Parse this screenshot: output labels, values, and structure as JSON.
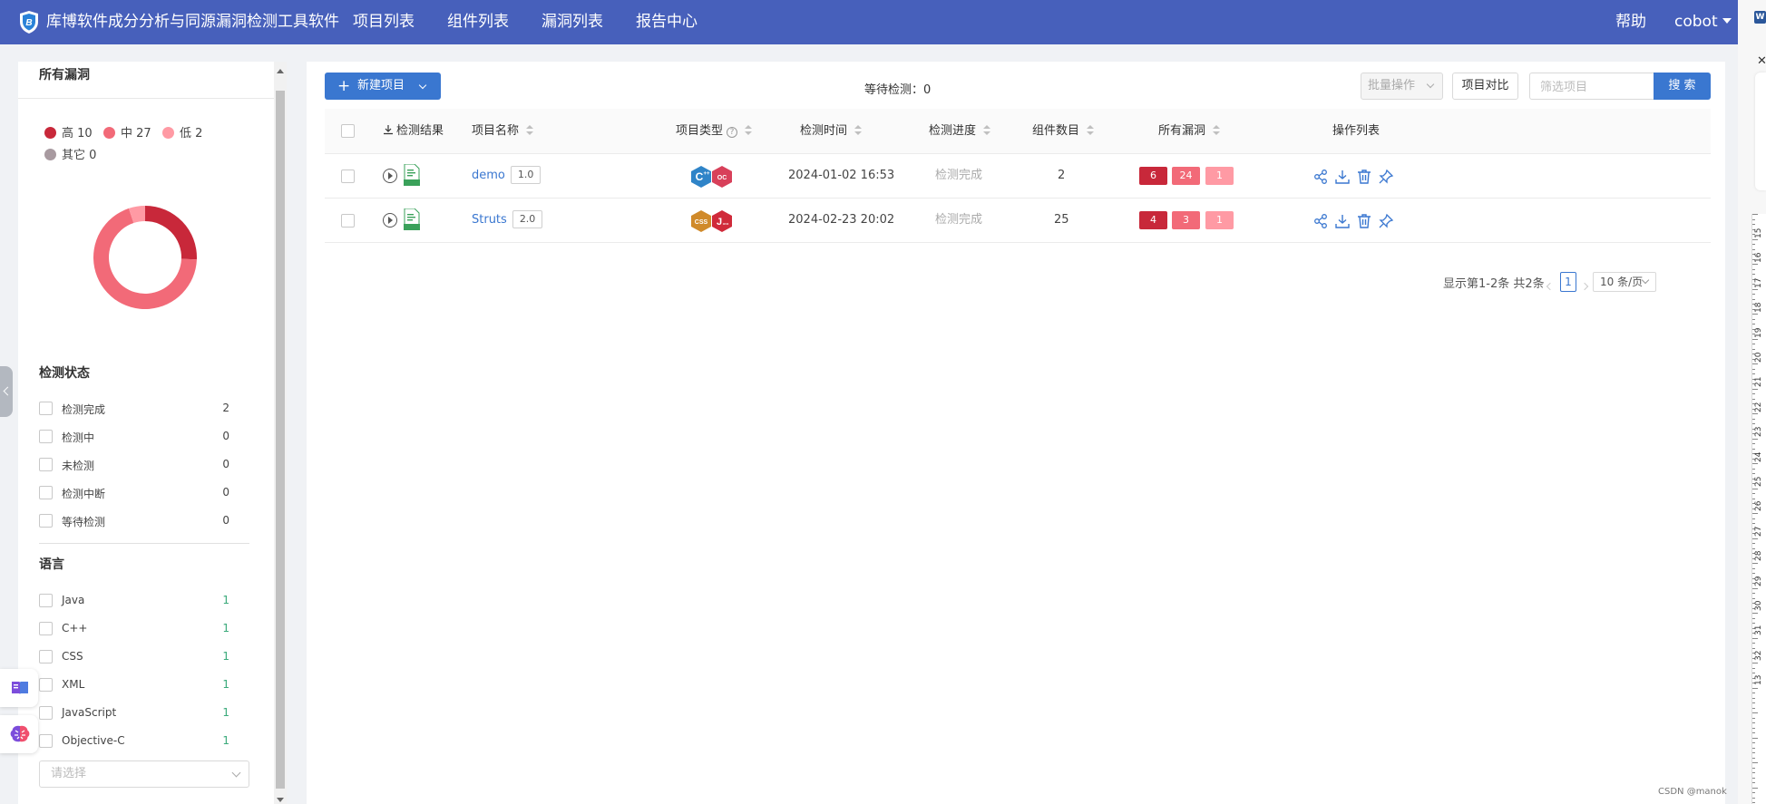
{
  "app": {
    "title": "库博软件成分分析与同源漏洞检测工具软件",
    "nav": [
      "项目列表",
      "组件列表",
      "漏洞列表",
      "报告中心"
    ],
    "help": "帮助",
    "user": "cobot"
  },
  "filters": {
    "vuln_title": "所有漏洞",
    "legend": [
      {
        "label": "高 10",
        "color": "#c8283a"
      },
      {
        "label": "中 27",
        "color": "#f26a78"
      },
      {
        "label": "低 2",
        "color": "#ff9aa4"
      },
      {
        "label": "其它 0",
        "color": "#a89aa0"
      }
    ],
    "status_title": "检测状态",
    "status": [
      {
        "label": "检测完成",
        "count": "2"
      },
      {
        "label": "检测中",
        "count": "0"
      },
      {
        "label": "未检测",
        "count": "0"
      },
      {
        "label": "检测中断",
        "count": "0"
      },
      {
        "label": "等待检测",
        "count": "0"
      }
    ],
    "lang_title": "语言",
    "languages": [
      {
        "label": "Java",
        "count": "1"
      },
      {
        "label": "C++",
        "count": "1"
      },
      {
        "label": "CSS",
        "count": "1"
      },
      {
        "label": "XML",
        "count": "1"
      },
      {
        "label": "JavaScript",
        "count": "1"
      },
      {
        "label": "Objective-C",
        "count": "1"
      }
    ],
    "select_placeholder": "请选择"
  },
  "toolbar": {
    "new_project": "新建项目",
    "waiting": "等待检测：0",
    "batch": "批量操作",
    "compare": "项目对比",
    "search_placeholder": "筛选项目",
    "search_btn": "搜 索"
  },
  "table": {
    "headers": [
      "检测结果",
      "项目名称",
      "项目类型",
      "检测时间",
      "检测进度",
      "组件数目",
      "所有漏洞",
      "操作列表"
    ],
    "rows": [
      {
        "name": "demo",
        "version": "1.0",
        "type_icons": [
          "c++",
          "objective-c"
        ],
        "time": "2024-01-02 16:53",
        "progress": "检测完成",
        "components": "2",
        "vulns": [
          "6",
          "24",
          "1"
        ]
      },
      {
        "name": "Struts",
        "version": "2.0",
        "type_icons": [
          "css",
          "java"
        ],
        "time": "2024-02-23 20:02",
        "progress": "检测完成",
        "components": "25",
        "vulns": [
          "4",
          "3",
          "1"
        ]
      }
    ]
  },
  "pagination": {
    "info": "显示第1-2条 共2条",
    "page": "1",
    "size": "10 条/页"
  },
  "icons": {
    "logo": "shield-logo-icon",
    "type_cpp": {
      "text": "C",
      "color": "#2f84c8"
    },
    "type_oc": {
      "text": "OC",
      "color": "#d8405a"
    },
    "type_css": {
      "text": "CSS",
      "color": "#d08a2a"
    },
    "type_java": {
      "text": "J",
      "color": "#d02a3a"
    }
  },
  "ruler_numbers": [
    "15",
    "16",
    "17",
    "18",
    "19",
    "20",
    "21",
    "22",
    "23",
    "24",
    "25",
    "26",
    "27",
    "28",
    "29",
    "30",
    "31",
    "32",
    "13"
  ],
  "watermark": "CSDN @manok",
  "colors": {
    "topbar": "#4760bb",
    "primary": "#3a77d0",
    "high": "#c8283a",
    "medium": "#f26a78",
    "low": "#ff9aa4"
  }
}
